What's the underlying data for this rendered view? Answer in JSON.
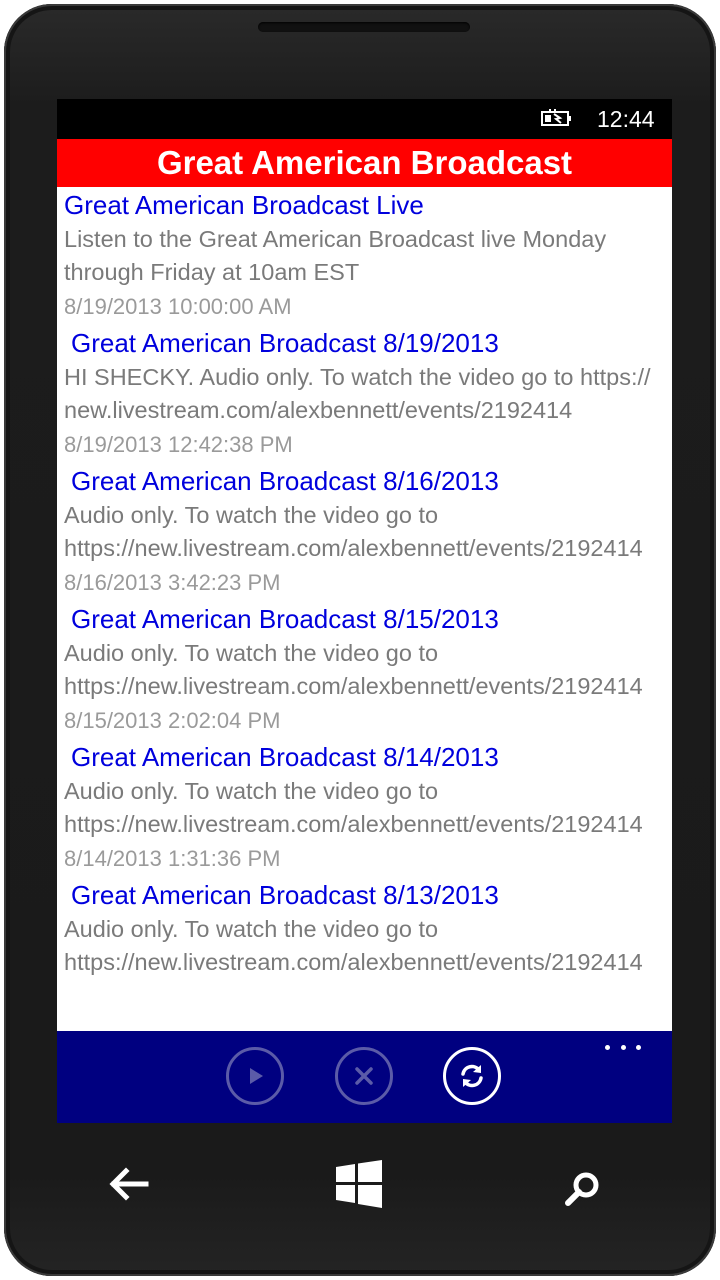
{
  "status_bar": {
    "time": "12:44"
  },
  "app": {
    "title": "Great American Broadcast"
  },
  "feed": [
    {
      "title": "Great American Broadcast Live",
      "description": "Listen to the Great American Broadcast live Monday through Friday at 10am EST",
      "date": "8/19/2013 10:00:00 AM"
    },
    {
      "title": "Great American Broadcast 8/19/2013",
      "description": "HI SHECKY.  Audio only.  To watch the video go to https://new.livestream.com/alexbennett/events/2192414",
      "date": "8/19/2013 12:42:38 PM"
    },
    {
      "title": "Great American Broadcast 8/16/2013",
      "description": "Audio only.  To watch the video go to https://new.livestream.com/alexbennett/events/2192414",
      "date": "8/16/2013 3:42:23 PM"
    },
    {
      "title": "Great American Broadcast 8/15/2013",
      "description": "Audio only.  To watch the video go to https://new.livestream.com/alexbennett/events/2192414",
      "date": "8/15/2013 2:02:04 PM"
    },
    {
      "title": "Great American Broadcast 8/14/2013",
      "description": "Audio only.  To watch the video go to https://new.livestream.com/alexbennett/events/2192414",
      "date": "8/14/2013 1:31:36 PM"
    },
    {
      "title": "Great American Broadcast 8/13/2013",
      "description": "Audio only.  To watch the video go to https://new.livestream.com/alexbennett/events/2192414",
      "date": ""
    }
  ],
  "app_bar": {
    "buttons": [
      {
        "icon": "play-icon",
        "enabled": false
      },
      {
        "icon": "close-icon",
        "enabled": false
      },
      {
        "icon": "refresh-icon",
        "enabled": true
      }
    ],
    "more_icon": "ellipsis-icon"
  },
  "hardware_keys": [
    "back-arrow-icon",
    "windows-logo-icon",
    "search-icon"
  ],
  "colors": {
    "title_bar": "#ff0000",
    "app_bar": "#000080",
    "item_title": "#0000dd",
    "item_text": "#7a7a7a"
  }
}
